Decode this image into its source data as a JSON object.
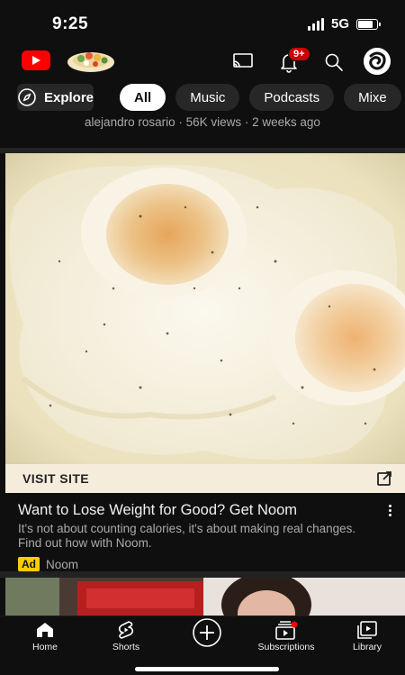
{
  "status_bar": {
    "time": "9:25",
    "network": "5G"
  },
  "header": {
    "notification_badge": "9+",
    "icons": [
      "youtube-logo",
      "doodle",
      "cast-icon",
      "bell-icon",
      "search-icon",
      "account-avatar"
    ]
  },
  "chips": {
    "explore_label": "Explore",
    "items": [
      "All",
      "Music",
      "Podcasts",
      "Mixe"
    ],
    "active": "All"
  },
  "previous_video": {
    "meta": "alejandro rosario · 56K views · 2 weeks ago"
  },
  "ad": {
    "visit_label": "VISIT SITE",
    "title": "Want to Lose Weight for Good? Get Noom",
    "description": "It's not about counting calories, it's about making real changes. Find out how with Noom.",
    "badge": "Ad",
    "advertiser": "Noom"
  },
  "bottom_nav": {
    "home": "Home",
    "shorts": "Shorts",
    "subscriptions": "Subscriptions",
    "library": "Library"
  },
  "colors": {
    "background": "#0f0f0f",
    "accent_red": "#ff0000",
    "ad_badge": "#ffcc00",
    "visit_bar": "#f6ecdc"
  }
}
